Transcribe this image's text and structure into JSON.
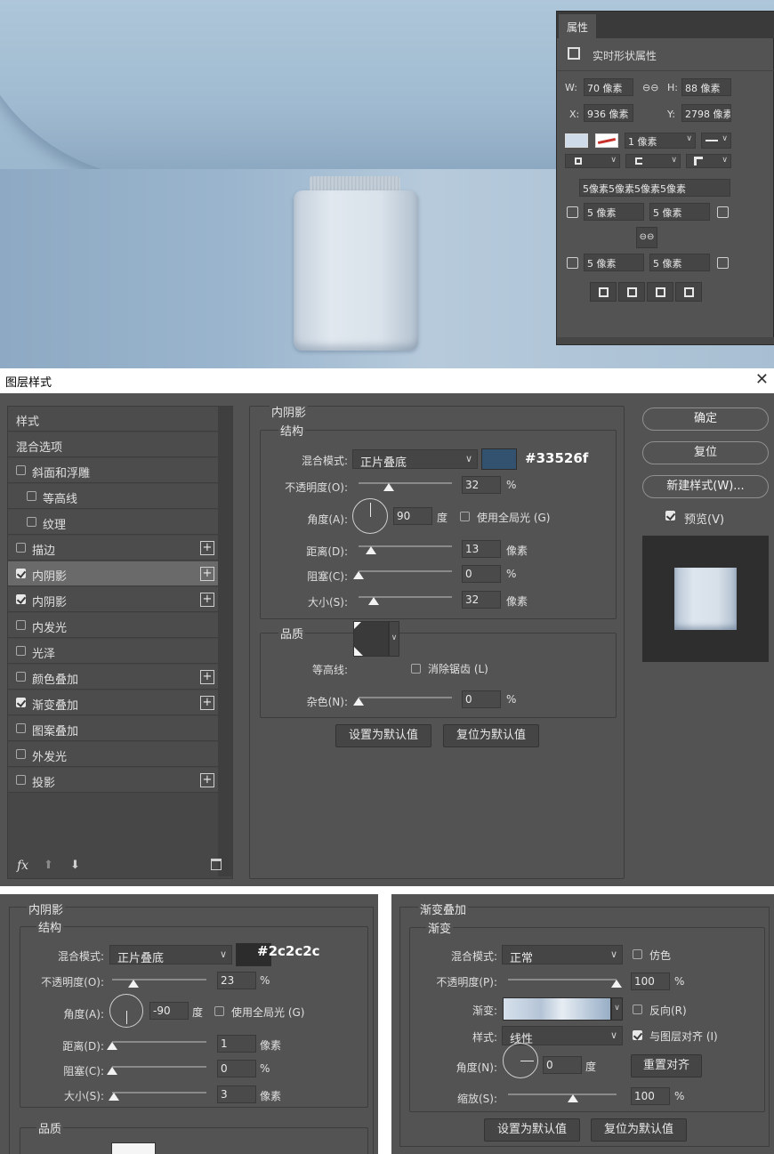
{
  "properties_panel": {
    "tab_label": "属性",
    "shape_title": "实时形状属性",
    "w_label": "W:",
    "w_value": "70 像素",
    "h_label": "H:",
    "h_value": "88 像素",
    "x_label": "X:",
    "x_value": "936 像素",
    "y_label": "Y:",
    "y_value": "2798 像素",
    "stroke_width": "1 像素",
    "radius_combined": "5像素5像素5像素5像素",
    "corner_tl": "5 像素",
    "corner_tr": "5 像素",
    "corner_bl": "5 像素",
    "corner_br": "5 像素",
    "fill_color": "#cfdbe8"
  },
  "dialog": {
    "title": "图层样式",
    "close_glyph": "✕",
    "style_list": [
      {
        "label": "样式",
        "checkbox": false,
        "checked": false,
        "plus": false,
        "indent": 0,
        "selected": false
      },
      {
        "label": "混合选项",
        "checkbox": false,
        "checked": false,
        "plus": false,
        "indent": 0,
        "selected": false
      },
      {
        "label": "斜面和浮雕",
        "checkbox": true,
        "checked": false,
        "plus": false,
        "indent": 0,
        "selected": false
      },
      {
        "label": "等高线",
        "checkbox": true,
        "checked": false,
        "plus": false,
        "indent": 1,
        "selected": false
      },
      {
        "label": "纹理",
        "checkbox": true,
        "checked": false,
        "plus": false,
        "indent": 1,
        "selected": false
      },
      {
        "label": "描边",
        "checkbox": true,
        "checked": false,
        "plus": true,
        "indent": 0,
        "selected": false
      },
      {
        "label": "内阴影",
        "checkbox": true,
        "checked": true,
        "plus": true,
        "indent": 0,
        "selected": true
      },
      {
        "label": "内阴影",
        "checkbox": true,
        "checked": true,
        "plus": true,
        "indent": 0,
        "selected": false
      },
      {
        "label": "内发光",
        "checkbox": true,
        "checked": false,
        "plus": false,
        "indent": 0,
        "selected": false
      },
      {
        "label": "光泽",
        "checkbox": true,
        "checked": false,
        "plus": false,
        "indent": 0,
        "selected": false
      },
      {
        "label": "颜色叠加",
        "checkbox": true,
        "checked": false,
        "plus": true,
        "indent": 0,
        "selected": false
      },
      {
        "label": "渐变叠加",
        "checkbox": true,
        "checked": true,
        "plus": true,
        "indent": 0,
        "selected": false
      },
      {
        "label": "图案叠加",
        "checkbox": true,
        "checked": false,
        "plus": false,
        "indent": 0,
        "selected": false
      },
      {
        "label": "外发光",
        "checkbox": true,
        "checked": false,
        "plus": false,
        "indent": 0,
        "selected": false
      },
      {
        "label": "投影",
        "checkbox": true,
        "checked": false,
        "plus": true,
        "indent": 0,
        "selected": false
      }
    ],
    "footer_fx": "fx",
    "inner_shadow": {
      "section_title": "内阴影",
      "structure_title": "结构",
      "blend_label": "混合模式:",
      "blend_value": "正片叠底",
      "color": "#33526f",
      "color_hex_label": "#33526f",
      "opacity_label": "不透明度(O):",
      "opacity_value": "32",
      "opacity_unit": "%",
      "opacity_level": 0.32,
      "angle_label": "角度(A):",
      "angle_value": "90",
      "angle_unit": "度",
      "global_light_label": "使用全局光 (G)",
      "distance_label": "距离(D):",
      "distance_value": "13",
      "distance_unit": "像素",
      "distance_level": 0.13,
      "choke_label": "阻塞(C):",
      "choke_value": "0",
      "choke_unit": "%",
      "choke_level": 0,
      "size_label": "大小(S):",
      "size_value": "32",
      "size_unit": "像素",
      "size_level": 0.16,
      "quality_title": "品质",
      "contour_label": "等高线:",
      "antialias_label": "消除锯齿 (L)",
      "noise_label": "杂色(N):",
      "noise_value": "0",
      "noise_unit": "%",
      "noise_level": 0,
      "set_default_label": "设置为默认值",
      "reset_default_label": "复位为默认值"
    },
    "buttons": {
      "ok": "确定",
      "reset": "复位",
      "new_style": "新建样式(W)...",
      "preview": "预览(V)"
    }
  },
  "inner_shadow_2": {
    "section_title": "内阴影",
    "structure_title": "结构",
    "blend_label": "混合模式:",
    "blend_value": "正片叠底",
    "color": "#2c2c2c",
    "color_hex_label": "#2c2c2c",
    "opacity_label": "不透明度(O):",
    "opacity_value": "23",
    "opacity_unit": "%",
    "opacity_level": 0.23,
    "angle_label": "角度(A):",
    "angle_value": "-90",
    "angle_unit": "度",
    "global_light_label": "使用全局光 (G)",
    "distance_label": "距离(D):",
    "distance_value": "1",
    "distance_unit": "像素",
    "distance_level": 0.0,
    "choke_label": "阻塞(C):",
    "choke_value": "0",
    "choke_unit": "%",
    "choke_level": 0,
    "size_label": "大小(S):",
    "size_value": "3",
    "size_unit": "像素",
    "size_level": 0.02,
    "quality_title": "品质"
  },
  "gradient_overlay": {
    "section_title": "渐变叠加",
    "sub_title": "渐变",
    "blend_label": "混合模式:",
    "blend_value": "正常",
    "dither_label": "仿色",
    "opacity_label": "不透明度(P):",
    "opacity_value": "100",
    "opacity_unit": "%",
    "opacity_level": 1.0,
    "gradient_label": "渐变:",
    "reverse_label": "反向(R)",
    "style_label": "样式:",
    "style_value": "线性",
    "align_label": "与图层对齐 (I)",
    "angle_label": "角度(N):",
    "angle_value": "0",
    "angle_unit": "度",
    "reset_align_label": "重置对齐",
    "scale_label": "缩放(S):",
    "scale_value": "100",
    "scale_unit": "%",
    "scale_level": 0.6,
    "set_default_label": "设置为默认值",
    "reset_default_label": "复位为默认值"
  }
}
